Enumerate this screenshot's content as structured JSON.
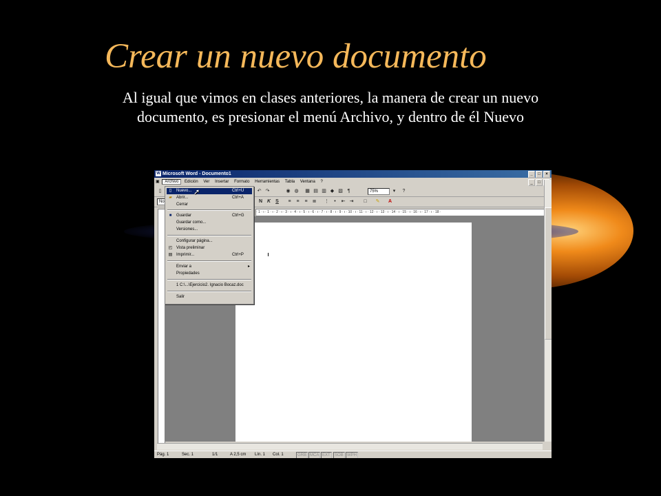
{
  "slide": {
    "title": "Crear un nuevo documento",
    "body": "Al igual que vimos en clases anteriores, la manera de crear un nuevo documento, es presionar el menú Archivo, y dentro de él Nuevo"
  },
  "window": {
    "title": "Microsoft Word - Documento1",
    "controls": [
      "_",
      "□",
      "×"
    ],
    "doc_controls": [
      "_",
      "□",
      "×"
    ]
  },
  "menubar": [
    "Archivo",
    "Edición",
    "Ver",
    "Insertar",
    "Formato",
    "Herramientas",
    "Tabla",
    "Ventana",
    "?"
  ],
  "zoom": "75%",
  "style_box": "No",
  "format_buttons": [
    "N",
    "K",
    "S"
  ],
  "ruler": "· 1 · ı · 1 · ı · 2 · ı · 3 · ı · 4 · ı · 5 · ı · 6 · ı · 7 · ı · 8 · ı · 9 · ı · 10 · ı · 11 · ı · 12 · ı · 13 · ı · 14 · ı · 15 · ı · 16 · ı · 17 · ı · 18 ·",
  "file_menu": {
    "items": [
      {
        "label": "Nuevo...",
        "shortcut": "Ctrl+U",
        "icon": "new-doc-icon",
        "selected": true
      },
      {
        "label": "Abrir...",
        "shortcut": "Ctrl+A",
        "icon": "open-folder-icon"
      },
      {
        "label": "Cerrar",
        "shortcut": ""
      },
      {
        "label": "Guardar",
        "shortcut": "Ctrl+G",
        "icon": "save-disk-icon"
      },
      {
        "label": "Guardar como...",
        "shortcut": ""
      },
      {
        "label": "Versiones...",
        "shortcut": ""
      },
      {
        "label": "Configurar página...",
        "shortcut": ""
      },
      {
        "label": "Vista preliminar",
        "shortcut": "",
        "icon": "print-preview-icon"
      },
      {
        "label": "Imprimir...",
        "shortcut": "Ctrl+P",
        "icon": "printer-icon"
      },
      {
        "label": "Enviar a",
        "shortcut": "",
        "submenu": "▸"
      },
      {
        "label": "Propiedades",
        "shortcut": ""
      },
      {
        "label": "1 C:\\...\\Ejercicio2. Ignacio Bocaz.doc",
        "shortcut": ""
      },
      {
        "label": "Salir",
        "shortcut": ""
      }
    ]
  },
  "status": {
    "page": "Pág. 1",
    "section": "Sec. 1",
    "pages": "1/1",
    "at": "A 2,5 cm",
    "line": "Lín. 1",
    "col": "Col. 1",
    "modes": [
      "GRB",
      "MCA",
      "EXT",
      "SOB",
      "WPH"
    ]
  }
}
